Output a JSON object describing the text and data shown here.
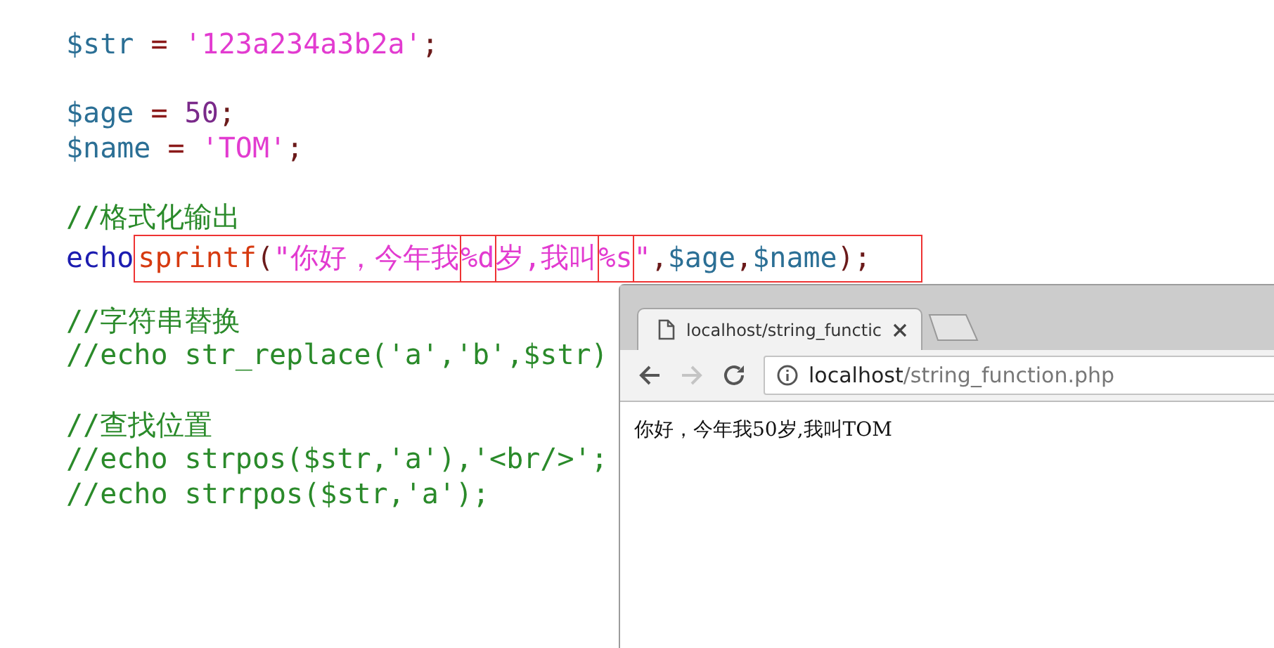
{
  "editor": {
    "lines": [
      {
        "kind": "code",
        "segments": [
          {
            "outlined": false,
            "tokens": [
              {
                "kind": "variable",
                "text": "$str",
                "outlined": false
              },
              {
                "kind": "operator",
                "text": " = ",
                "outlined": false
              },
              {
                "kind": "string",
                "text": "'123a234a3b2a'",
                "outlined": false
              },
              {
                "kind": "punct",
                "text": ";",
                "outlined": false
              }
            ]
          }
        ]
      },
      {
        "kind": "blank"
      },
      {
        "kind": "code",
        "segments": [
          {
            "outlined": false,
            "tokens": [
              {
                "kind": "variable",
                "text": "$age",
                "outlined": false
              },
              {
                "kind": "operator",
                "text": " = ",
                "outlined": false
              },
              {
                "kind": "number",
                "text": "50",
                "outlined": false
              },
              {
                "kind": "punct",
                "text": ";",
                "outlined": false
              }
            ]
          }
        ]
      },
      {
        "kind": "code",
        "segments": [
          {
            "outlined": false,
            "tokens": [
              {
                "kind": "variable",
                "text": "$name",
                "outlined": false
              },
              {
                "kind": "operator",
                "text": " = ",
                "outlined": false
              },
              {
                "kind": "string",
                "text": "'TOM'",
                "outlined": false
              },
              {
                "kind": "punct",
                "text": ";",
                "outlined": false
              }
            ]
          }
        ]
      },
      {
        "kind": "blank"
      },
      {
        "kind": "code",
        "segments": [
          {
            "outlined": false,
            "tokens": [
              {
                "kind": "comment",
                "text": "//格式化输出",
                "outlined": false
              }
            ]
          }
        ]
      },
      {
        "kind": "code",
        "segments": [
          {
            "outlined": false,
            "tokens": [
              {
                "kind": "keyword",
                "text": "echo",
                "outlined": false
              }
            ]
          },
          {
            "outlined": true,
            "tokens": [
              {
                "kind": "function",
                "text": "sprintf",
                "outlined": false
              },
              {
                "kind": "punct",
                "text": "(",
                "outlined": false
              },
              {
                "kind": "string",
                "text": "\"你好，今年我",
                "outlined": false
              },
              {
                "kind": "string",
                "text": "%d",
                "outlined": true
              },
              {
                "kind": "string",
                "text": "岁,我叫",
                "outlined": false
              },
              {
                "kind": "string",
                "text": "%s",
                "outlined": true
              },
              {
                "kind": "string",
                "text": "\"",
                "outlined": false
              },
              {
                "kind": "punct",
                "text": ",",
                "outlined": false
              },
              {
                "kind": "variable",
                "text": "$age",
                "outlined": false
              },
              {
                "kind": "punct",
                "text": ",",
                "outlined": false
              },
              {
                "kind": "variable",
                "text": "$name",
                "outlined": false
              },
              {
                "kind": "punct",
                "text": ");",
                "outlined": false
              }
            ]
          }
        ]
      },
      {
        "kind": "blank"
      },
      {
        "kind": "code",
        "segments": [
          {
            "outlined": false,
            "tokens": [
              {
                "kind": "comment",
                "text": "//字符串替换",
                "outlined": false
              }
            ]
          }
        ]
      },
      {
        "kind": "code",
        "segments": [
          {
            "outlined": false,
            "tokens": [
              {
                "kind": "comment",
                "text": "//echo str_replace('a','b',$str)",
                "outlined": false
              }
            ]
          }
        ]
      },
      {
        "kind": "blank"
      },
      {
        "kind": "code",
        "segments": [
          {
            "outlined": false,
            "tokens": [
              {
                "kind": "comment",
                "text": "//查找位置",
                "outlined": false
              }
            ]
          }
        ]
      },
      {
        "kind": "code",
        "segments": [
          {
            "outlined": false,
            "tokens": [
              {
                "kind": "comment",
                "text": "//echo strpos($str,'a'),'<br/>';",
                "outlined": false
              }
            ]
          }
        ]
      },
      {
        "kind": "code",
        "segments": [
          {
            "outlined": false,
            "tokens": [
              {
                "kind": "comment",
                "text": "//echo strrpos($str,'a');",
                "outlined": false
              }
            ]
          }
        ]
      }
    ]
  },
  "browser": {
    "tabs": [
      {
        "title": "localhost/string_functic",
        "selected": true
      }
    ],
    "toolbar_buttons": [
      {
        "kind": "back",
        "disabled": false
      },
      {
        "kind": "forward",
        "disabled": true
      },
      {
        "kind": "reload",
        "disabled": false
      }
    ],
    "address": {
      "host": "localhost",
      "path": "/string_function.php"
    },
    "page": {
      "text": "你好，今年我50岁,我叫TOM"
    }
  }
}
